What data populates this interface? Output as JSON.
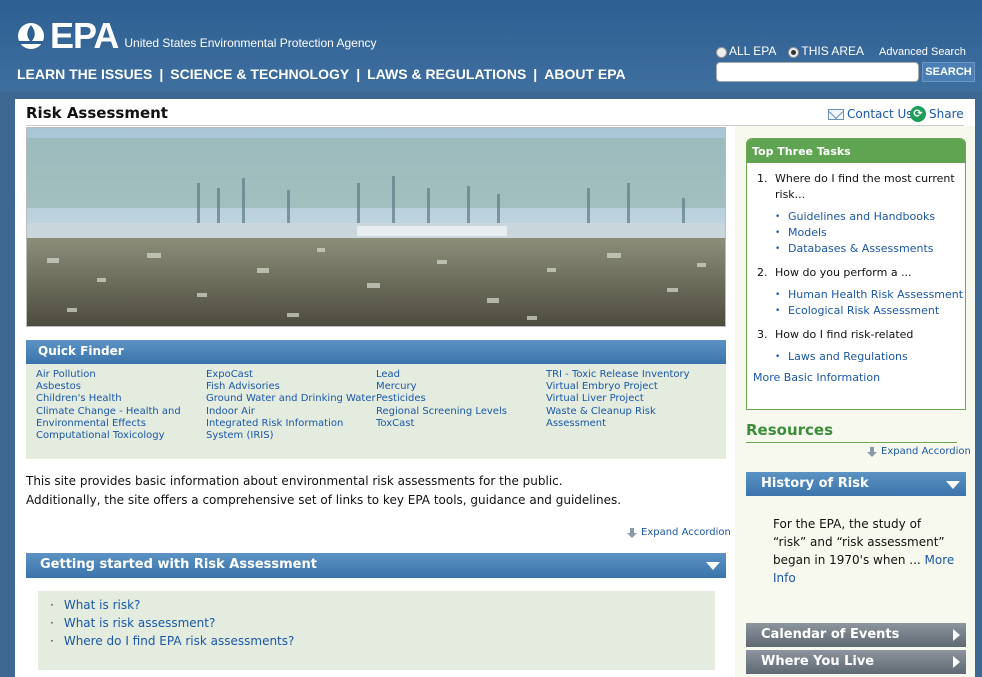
{
  "header": {
    "logo_text": "EPA",
    "agency_name": "United States Environmental Protection Agency",
    "nav": [
      "LEARN THE ISSUES",
      "SCIENCE & TECHNOLOGY",
      "LAWS & REGULATIONS",
      "ABOUT EPA"
    ],
    "nav_separator": "|",
    "search": {
      "option_all": "ALL EPA",
      "option_area": "THIS AREA",
      "selected": "THIS AREA",
      "advanced_label": "Advanced Search",
      "value": "",
      "button_label": "SEARCH"
    }
  },
  "page": {
    "title": "Risk Assessment",
    "contact_label": "Contact Us",
    "share_label": "Share"
  },
  "quick_finder": {
    "title": "Quick Finder",
    "columns": [
      [
        "Air Pollution",
        "Asbestos",
        "Children's Health",
        "Climate Change - Health and Environmental Effects",
        "Computational Toxicology"
      ],
      [
        "ExpoCast",
        "Fish Advisories",
        "Ground Water and Drinking Water",
        "Indoor Air",
        "Integrated Risk Information System (IRIS)"
      ],
      [
        "Lead",
        "Mercury",
        "Pesticides",
        "Regional Screening Levels",
        "ToxCast"
      ],
      [
        "TRI - Toxic Release Inventory",
        "Virtual Embryo Project",
        "Virtual Liver Project",
        "Waste & Cleanup Risk Assessment"
      ]
    ]
  },
  "intro": {
    "line1": "This site provides basic information about environmental risk assessments for the public.",
    "line2": "Additionally, the site offers a comprehensive set of links to key EPA tools, guidance and guidelines."
  },
  "expand_label": "Expand Accordion",
  "getting_started": {
    "title": "Getting started with Risk Assessment",
    "items": [
      "What is risk?",
      "What is risk assessment?",
      "Where do I find EPA risk assessments?"
    ]
  },
  "top_tasks": {
    "title": "Top Three Tasks",
    "tasks": [
      {
        "num": "1.",
        "question": "Where do I find the most current risk...",
        "links": [
          "Guidelines and Handbooks",
          "Models",
          "Databases & Assessments"
        ]
      },
      {
        "num": "2.",
        "question": "How do you perform a ...",
        "links": [
          "Human Health Risk Assessment",
          "Ecological Risk Assessment"
        ]
      },
      {
        "num": "3.",
        "question": "How do I find risk-related",
        "links": [
          "Laws and Regulations"
        ]
      }
    ],
    "more_label": "More Basic Information"
  },
  "resources": {
    "title": "Resources",
    "history": {
      "title": "History of Risk",
      "text": "For the EPA, the study of “risk” and “risk assessment” began in 1970's when ...",
      "more_label": "More Info"
    },
    "calendar_title": "Calendar of Events",
    "where_title": "Where You Live"
  },
  "colors": {
    "header_blue": "#2e5f92",
    "accent_green": "#5fa551",
    "panel_green": "#e3ecdf",
    "link_blue": "#1b57a6"
  }
}
